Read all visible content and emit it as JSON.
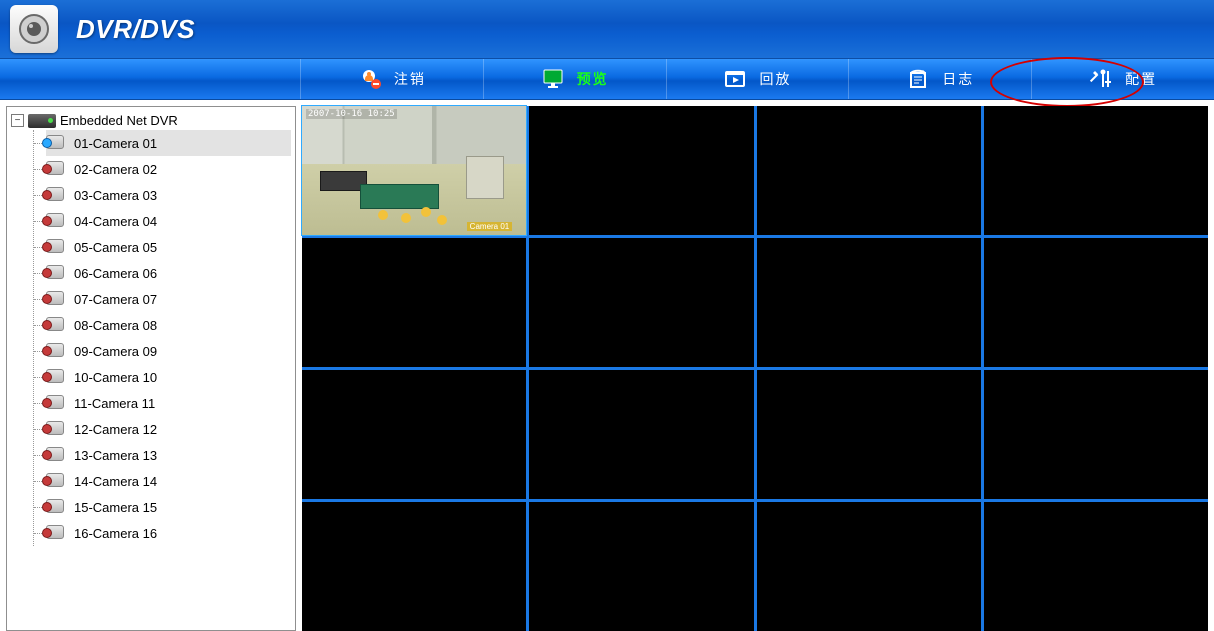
{
  "header": {
    "title": "DVR/DVS"
  },
  "nav": {
    "items": [
      {
        "label": "注销",
        "icon": "logout"
      },
      {
        "label": "预览",
        "icon": "preview",
        "active": true
      },
      {
        "label": "回放",
        "icon": "playback"
      },
      {
        "label": "日志",
        "icon": "log"
      },
      {
        "label": "配置",
        "icon": "config"
      }
    ]
  },
  "tree": {
    "root_label": "Embedded Net DVR",
    "expand_symbol": "−",
    "cameras": [
      {
        "label": "01-Camera 01",
        "live": true,
        "selected": true
      },
      {
        "label": "02-Camera 02"
      },
      {
        "label": "03-Camera 03"
      },
      {
        "label": "04-Camera 04"
      },
      {
        "label": "05-Camera 05"
      },
      {
        "label": "06-Camera 06"
      },
      {
        "label": "07-Camera 07"
      },
      {
        "label": "08-Camera 08"
      },
      {
        "label": "09-Camera 09"
      },
      {
        "label": "10-Camera 10"
      },
      {
        "label": "11-Camera 11"
      },
      {
        "label": "12-Camera 12"
      },
      {
        "label": "13-Camera 13"
      },
      {
        "label": "14-Camera 14"
      },
      {
        "label": "15-Camera 15"
      },
      {
        "label": "16-Camera 16"
      }
    ]
  },
  "grid": {
    "active_cell_has_feed": true,
    "feed_timestamp": "2007-10-16 10:25",
    "feed_channel_label": "Camera 01"
  }
}
